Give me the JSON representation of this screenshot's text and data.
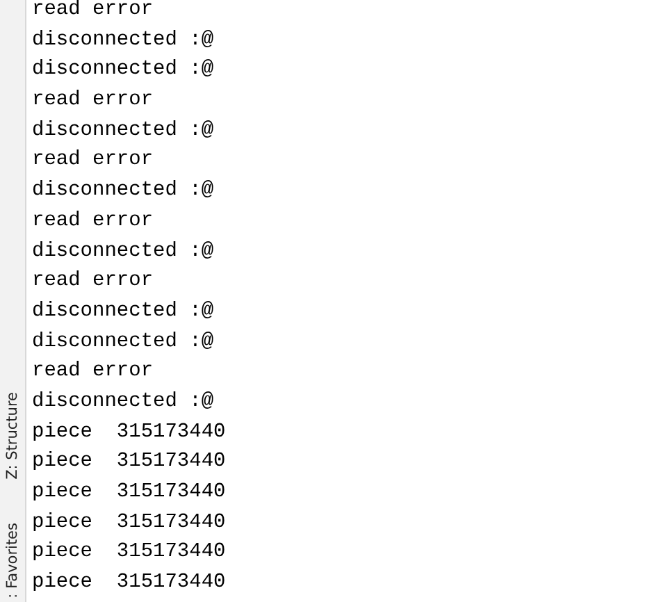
{
  "sidebar": {
    "tabs": [
      {
        "label": "Z: Structure"
      },
      {
        "label": ": Favorites"
      }
    ]
  },
  "console": {
    "lines": [
      "read error",
      "disconnected :@",
      "disconnected :@",
      "read error",
      "disconnected :@",
      "read error",
      "disconnected :@",
      "read error",
      "disconnected :@",
      "read error",
      "disconnected :@",
      "disconnected :@",
      "read error",
      "disconnected :@",
      "piece  315173440",
      "piece  315173440",
      "piece  315173440",
      "piece  315173440",
      "piece  315173440",
      "piece  315173440"
    ]
  }
}
